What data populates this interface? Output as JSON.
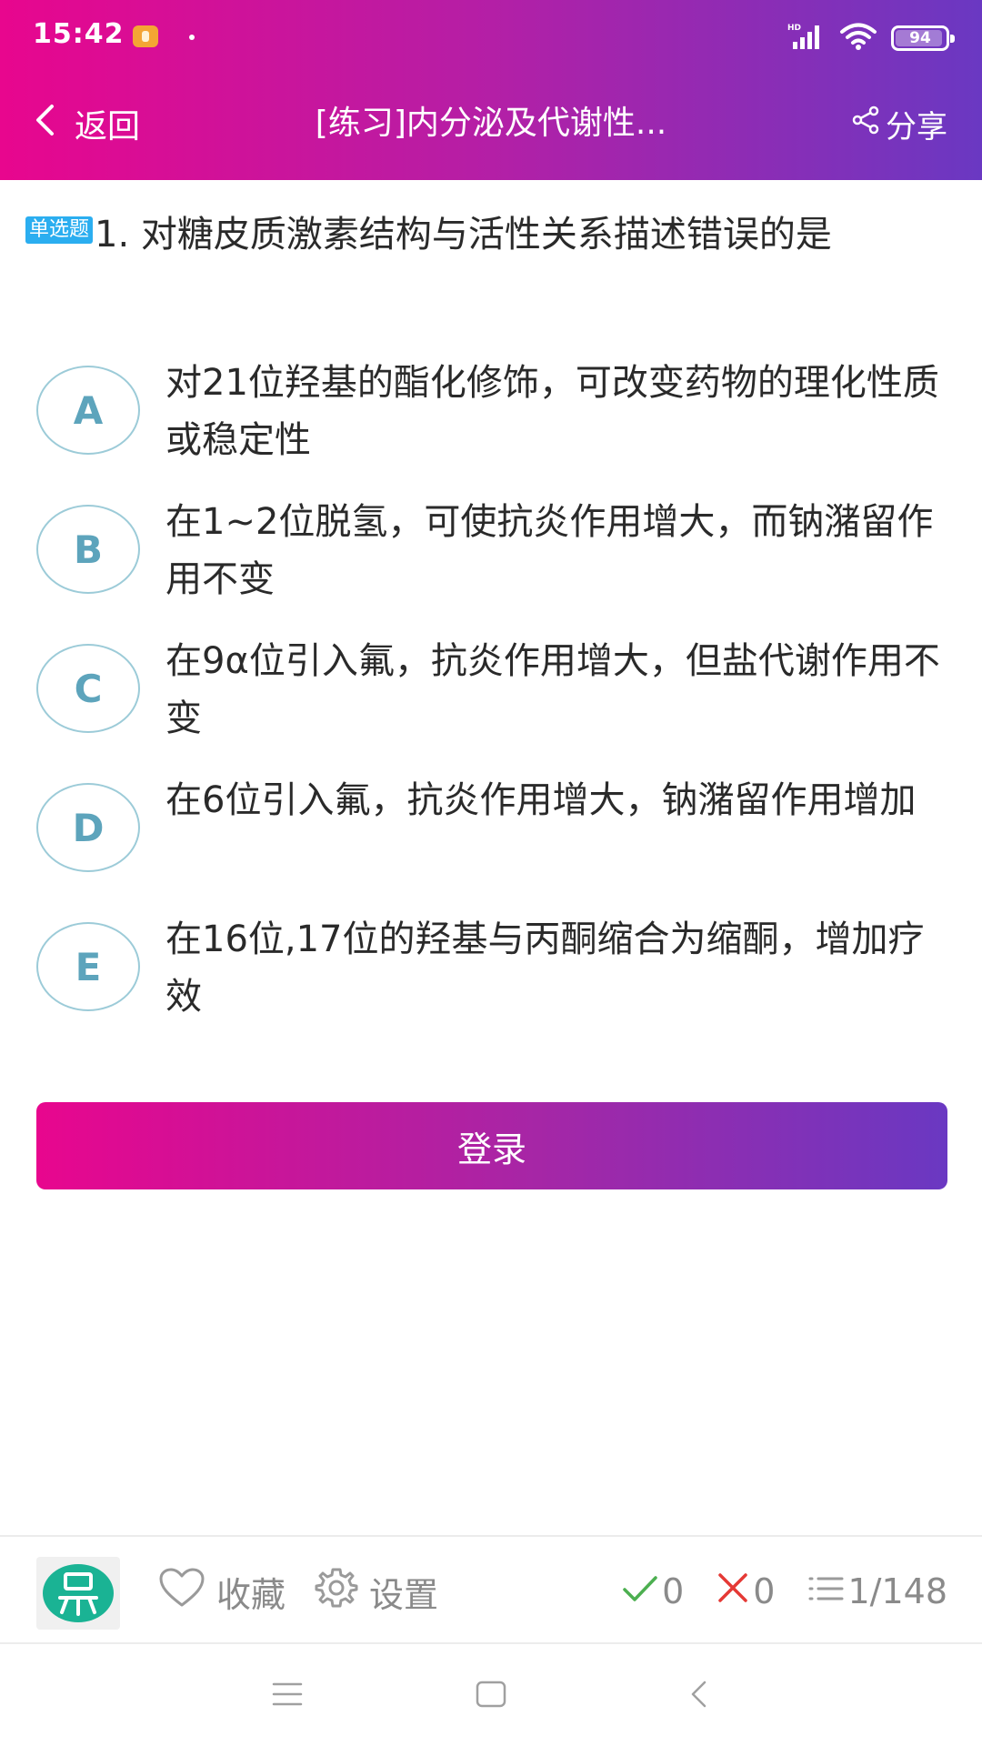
{
  "status_bar": {
    "time": "15:42",
    "network_label": "HD",
    "battery": "94",
    "battery_level": 0.94
  },
  "title_bar": {
    "back_label": "返回",
    "title": "[练习]内分泌及代谢性...",
    "share_label": "分享"
  },
  "question": {
    "type_badge": "单选题",
    "text": "1. 对糖皮质激素结构与活性关系描述错误的是"
  },
  "options": [
    {
      "letter": "A",
      "text": "对21位羟基的酯化修饰，可改变药物的理化性质或稳定性"
    },
    {
      "letter": "B",
      "text": "在1~2位脱氢，可使抗炎作用增大，而钠潴留作用不变"
    },
    {
      "letter": "C",
      "text": "在9α位引入氟，抗炎作用增大，但盐代谢作用不变"
    },
    {
      "letter": "D",
      "text": "在6位引入氟，抗炎作用增大，钠潴留作用增加"
    },
    {
      "letter": "E",
      "text": "在16位,17位的羟基与丙酮缩合为缩酮，增加疗效"
    }
  ],
  "login_button": {
    "label": "登录"
  },
  "toolbar": {
    "favorite_label": "收藏",
    "settings_label": "设置",
    "correct_count": "0",
    "wrong_count": "0",
    "progress": "1/148"
  },
  "colors": {
    "gradient_start": "#e8068e",
    "gradient_end": "#6a38c2",
    "badge": "#2baef0",
    "option_circle": "#5da4bc",
    "correct": "#4caf50",
    "wrong": "#e53935",
    "logo": "#1ab394"
  },
  "icons": {
    "back": "chevron-left-icon",
    "share": "share-icon",
    "favorite": "heart-icon",
    "settings": "gear-icon",
    "correct": "check-icon",
    "wrong": "cross-icon",
    "progress": "list-icon"
  }
}
